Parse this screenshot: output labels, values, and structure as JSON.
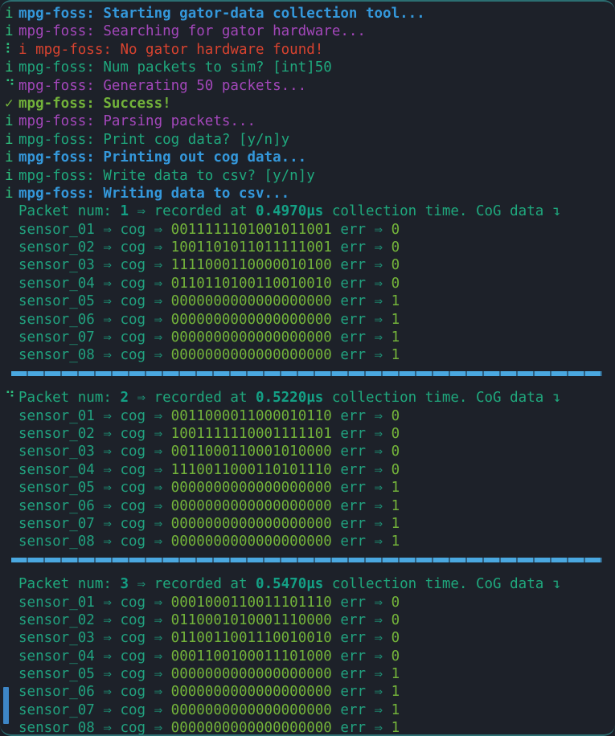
{
  "window": {
    "background": "#1d2129",
    "border_color": "#2b6f72",
    "scrollbar_color": "#3d86c6"
  },
  "app_name": "mpg-foss",
  "glyphs": {
    "info": "i",
    "success": "✓",
    "spinner_a": "⠇",
    "spinner_b": "⠙",
    "arrow": "⇒",
    "wrap_arrow": "↴",
    "blank": " "
  },
  "log": [
    {
      "gutter": "i",
      "gutter_class": "c-info",
      "prefix": "mpg-foss: ",
      "prefix_class": "c-blue",
      "message": "Starting gator-data collection tool...",
      "message_class": "c-blue"
    },
    {
      "gutter": "i",
      "gutter_class": "c-info",
      "prefix": "mpg-foss: ",
      "prefix_class": "c-purple",
      "message": "Searching for gator hardware...",
      "message_class": "c-purple"
    },
    {
      "gutter": "⠇",
      "gutter_class": "c-spin",
      "prefix": "i mpg-foss: ",
      "prefix_class": "c-red",
      "message": "No gator hardware found!",
      "message_class": "c-red"
    },
    {
      "gutter": "i",
      "gutter_class": "c-info",
      "prefix": "mpg-foss: ",
      "prefix_class": "c-green",
      "message": "Num packets to sim? [int]50",
      "message_class": "c-green"
    },
    {
      "gutter": "⠙",
      "gutter_class": "c-spin",
      "prefix": "mpg-foss: ",
      "prefix_class": "c-purple",
      "message": "Generating 50 packets...",
      "message_class": "c-purple"
    },
    {
      "gutter": "✓",
      "gutter_class": "c-ok",
      "prefix": "mpg-foss: ",
      "prefix_class": "c-greenb",
      "message": "Success!",
      "message_class": "c-greenb"
    },
    {
      "gutter": "i",
      "gutter_class": "c-info",
      "prefix": "mpg-foss: ",
      "prefix_class": "c-purple",
      "message": "Parsing packets...",
      "message_class": "c-purple"
    },
    {
      "gutter": "i",
      "gutter_class": "c-info",
      "prefix": "mpg-foss: ",
      "prefix_class": "c-green",
      "message": "Print cog data? [y/n]y",
      "message_class": "c-green"
    },
    {
      "gutter": "i",
      "gutter_class": "c-info",
      "prefix": "mpg-foss: ",
      "prefix_class": "c-blue",
      "message": "Printing out cog data...",
      "message_class": "c-blue"
    },
    {
      "gutter": "i",
      "gutter_class": "c-info",
      "prefix": "mpg-foss: ",
      "prefix_class": "c-green",
      "message": "Write data to csv? [y/n]y",
      "message_class": "c-green"
    },
    {
      "gutter": "i",
      "gutter_class": "c-info",
      "prefix": "mpg-foss: ",
      "prefix_class": "c-blue",
      "message": "Writing data to csv...",
      "message_class": "c-blue"
    }
  ],
  "packet_header": {
    "label_num": "Packet num:",
    "label_recorded": "recorded at",
    "label_tail": "collection time. CoG data",
    "units": "µs"
  },
  "row_labels": {
    "cog": "cog",
    "err": "err"
  },
  "packets": [
    {
      "gutter": " ",
      "gutter_class": "c-spin",
      "num": "1",
      "time": "0.4970",
      "sensors": [
        {
          "name": "sensor_01",
          "cog": "0011111101001011001",
          "err": "0"
        },
        {
          "name": "sensor_02",
          "cog": "1001101011011111001",
          "err": "0"
        },
        {
          "name": "sensor_03",
          "cog": "1111000110000010100",
          "err": "0"
        },
        {
          "name": "sensor_04",
          "cog": "0110110100110010010",
          "err": "0"
        },
        {
          "name": "sensor_05",
          "cog": "0000000000000000000",
          "err": "1"
        },
        {
          "name": "sensor_06",
          "cog": "0000000000000000000",
          "err": "1"
        },
        {
          "name": "sensor_07",
          "cog": "0000000000000000000",
          "err": "1"
        },
        {
          "name": "sensor_08",
          "cog": "0000000000000000000",
          "err": "1"
        }
      ]
    },
    {
      "gutter": "⠙",
      "gutter_class": "c-spin",
      "num": "2",
      "time": "0.5220",
      "sensors": [
        {
          "name": "sensor_01",
          "cog": "0011000011000010110",
          "err": "0"
        },
        {
          "name": "sensor_02",
          "cog": "1001111110001111101",
          "err": "0"
        },
        {
          "name": "sensor_03",
          "cog": "0011000110001010000",
          "err": "0"
        },
        {
          "name": "sensor_04",
          "cog": "1110011000110101110",
          "err": "0"
        },
        {
          "name": "sensor_05",
          "cog": "0000000000000000000",
          "err": "1"
        },
        {
          "name": "sensor_06",
          "cog": "0000000000000000000",
          "err": "1"
        },
        {
          "name": "sensor_07",
          "cog": "0000000000000000000",
          "err": "1"
        },
        {
          "name": "sensor_08",
          "cog": "0000000000000000000",
          "err": "1"
        }
      ]
    },
    {
      "gutter": " ",
      "gutter_class": "c-spin",
      "num": "3",
      "time": "0.5470",
      "sensors": [
        {
          "name": "sensor_01",
          "cog": "0001000110011101110",
          "err": "0"
        },
        {
          "name": "sensor_02",
          "cog": "0110001010001110000",
          "err": "0"
        },
        {
          "name": "sensor_03",
          "cog": "0110011001110010010",
          "err": "0"
        },
        {
          "name": "sensor_04",
          "cog": "0001100100011101000",
          "err": "0"
        },
        {
          "name": "sensor_05",
          "cog": "0000000000000000000",
          "err": "1"
        },
        {
          "name": "sensor_06",
          "cog": "0000000000000000000",
          "err": "1"
        },
        {
          "name": "sensor_07",
          "cog": "0000000000000000000",
          "err": "1"
        },
        {
          "name": "sensor_08",
          "cog": "0000000000000000000",
          "err": "1"
        }
      ]
    }
  ]
}
